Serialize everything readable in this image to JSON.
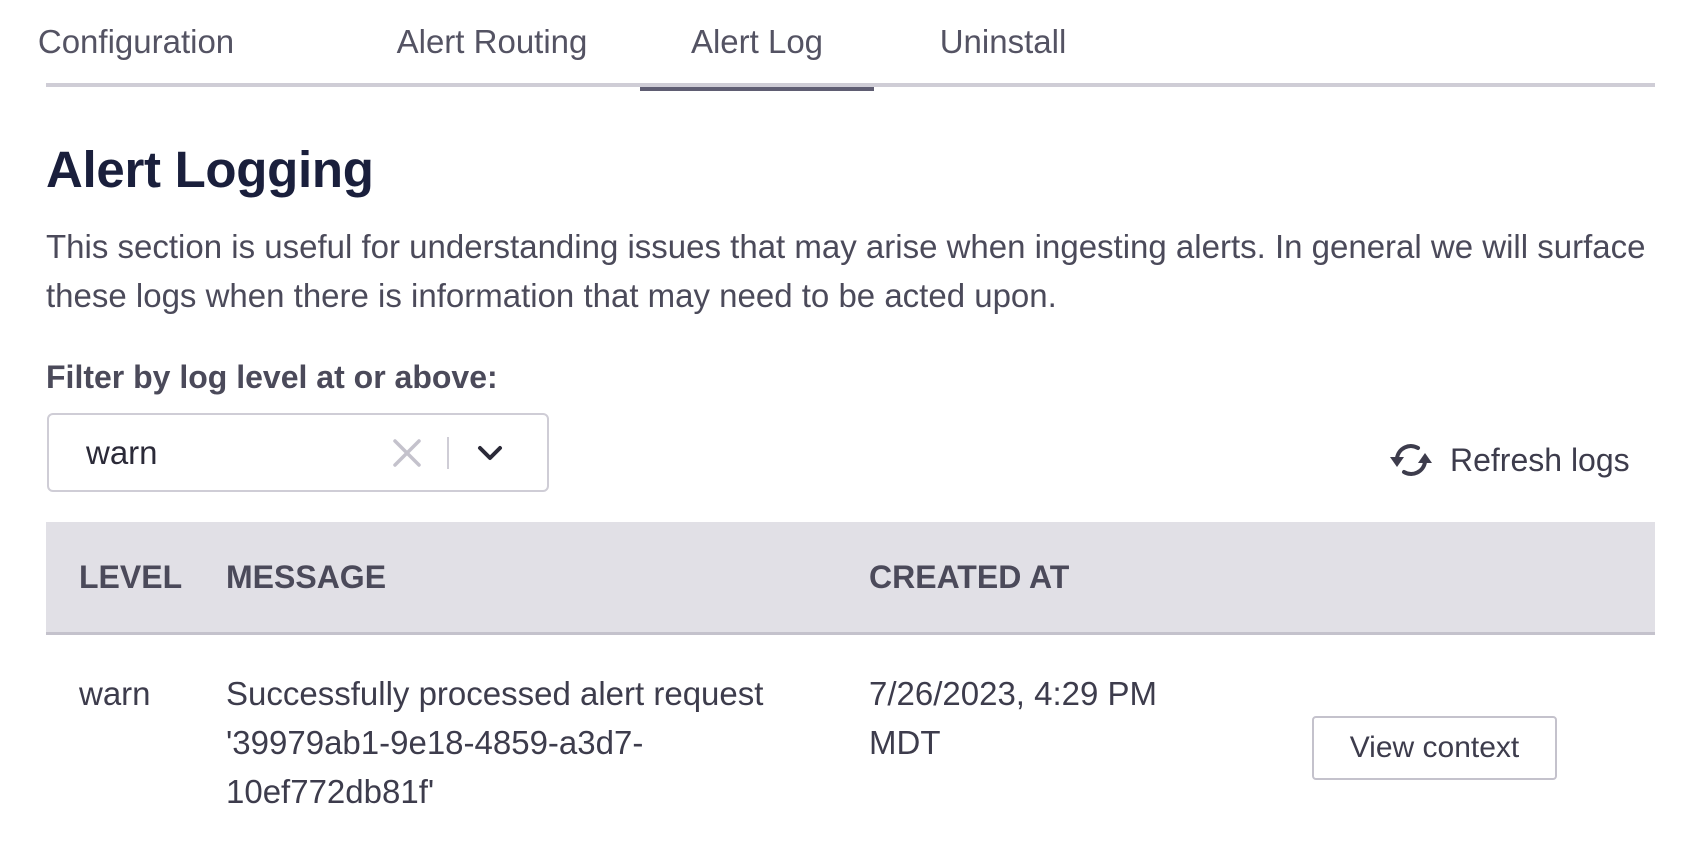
{
  "tabs": [
    {
      "label": "Configuration",
      "active": false
    },
    {
      "label": "Alert Routing",
      "active": false
    },
    {
      "label": "Alert Log",
      "active": true
    },
    {
      "label": "Uninstall",
      "active": false
    }
  ],
  "section": {
    "title": "Alert Logging",
    "description": "This section is useful for understanding issues that may arise when ingesting alerts. In general we will surface these logs when there is information that may need to be acted upon."
  },
  "filter": {
    "label": "Filter by log level at or above:",
    "selected_value": "warn",
    "clear_icon": "close-icon",
    "dropdown_icon": "chevron-down-icon"
  },
  "refresh": {
    "label": "Refresh logs",
    "icon": "refresh-icon"
  },
  "table": {
    "columns": [
      "LEVEL",
      "MESSAGE",
      "CREATED AT",
      ""
    ],
    "rows": [
      {
        "level": "warn",
        "message": "Successfully processed alert request '39979ab1-9e18-4859-a3d7-10ef772db81f'",
        "created_at": "7/26/2023, 4:29 PM MDT",
        "action_label": "View context"
      }
    ]
  },
  "colors": {
    "title": "#1a1f3c",
    "text": "#3d3c4c",
    "tab_active_indicator": "#5f5d72",
    "tab_border": "#cfcdd6",
    "table_header_bg": "#e1e0e6"
  }
}
